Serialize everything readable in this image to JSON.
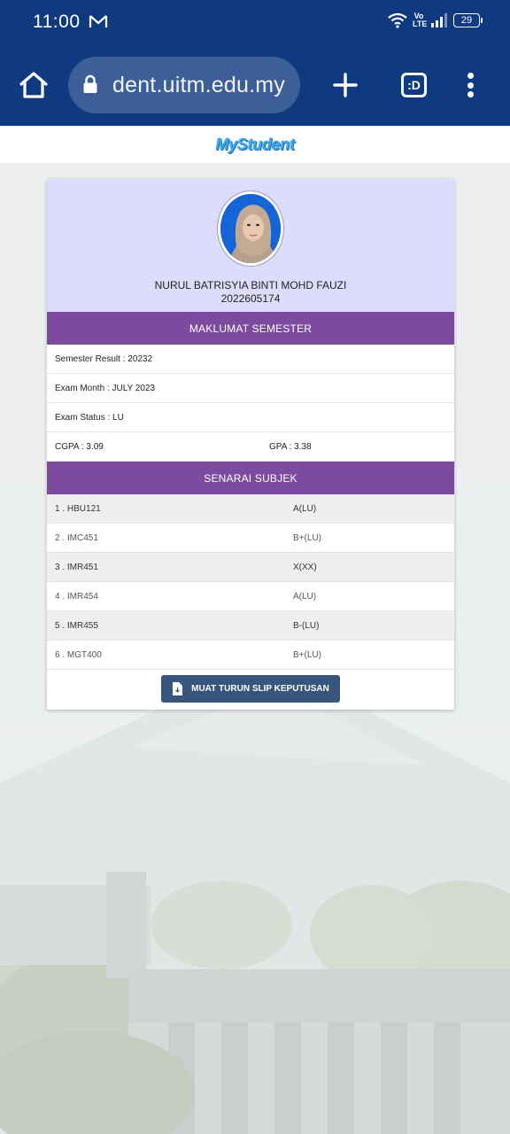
{
  "status_bar": {
    "time": "11:00",
    "volte": "Vo LTE",
    "battery": "29"
  },
  "browser": {
    "url": "dent.uitm.edu.my",
    "tabs_count": ":D"
  },
  "site": {
    "brand": "MyStudent"
  },
  "student": {
    "name": "NURUL BATRISYIA BINTI MOHD FAUZI",
    "id": "2022605174"
  },
  "semester": {
    "heading": "MAKLUMAT SEMESTER",
    "result": "Semester Result : 20232",
    "exam_month": "Exam Month : JULY 2023",
    "exam_status": "Exam Status : LU",
    "cgpa": "CGPA : 3.09",
    "gpa": "GPA : 3.38"
  },
  "subjects": {
    "heading": "SENARAI SUBJEK",
    "rows": [
      {
        "code": "1 . HBU121",
        "grade": "A(LU)"
      },
      {
        "code": "2 . IMC451",
        "grade": "B+(LU)"
      },
      {
        "code": "3 . IMR451",
        "grade": "X(XX)"
      },
      {
        "code": "4 . IMR454",
        "grade": "A(LU)"
      },
      {
        "code": "5 . IMR455",
        "grade": "B-(LU)"
      },
      {
        "code": "6 . MGT400",
        "grade": "B+(LU)"
      }
    ]
  },
  "download": {
    "label": "MUAT TURUN SLIP KEPUTUSAN"
  },
  "colors": {
    "browser_bar": "#0f3a80",
    "url_pill": "#3d5f98",
    "profile_bg": "#dcdcfc",
    "section_header": "#7c4a9e",
    "download_button": "#38557c"
  },
  "icons": {
    "home": "home-icon",
    "lock": "lock-icon",
    "new_tab": "plus-icon",
    "menu": "more-vert-icon",
    "download": "document-download-icon"
  }
}
